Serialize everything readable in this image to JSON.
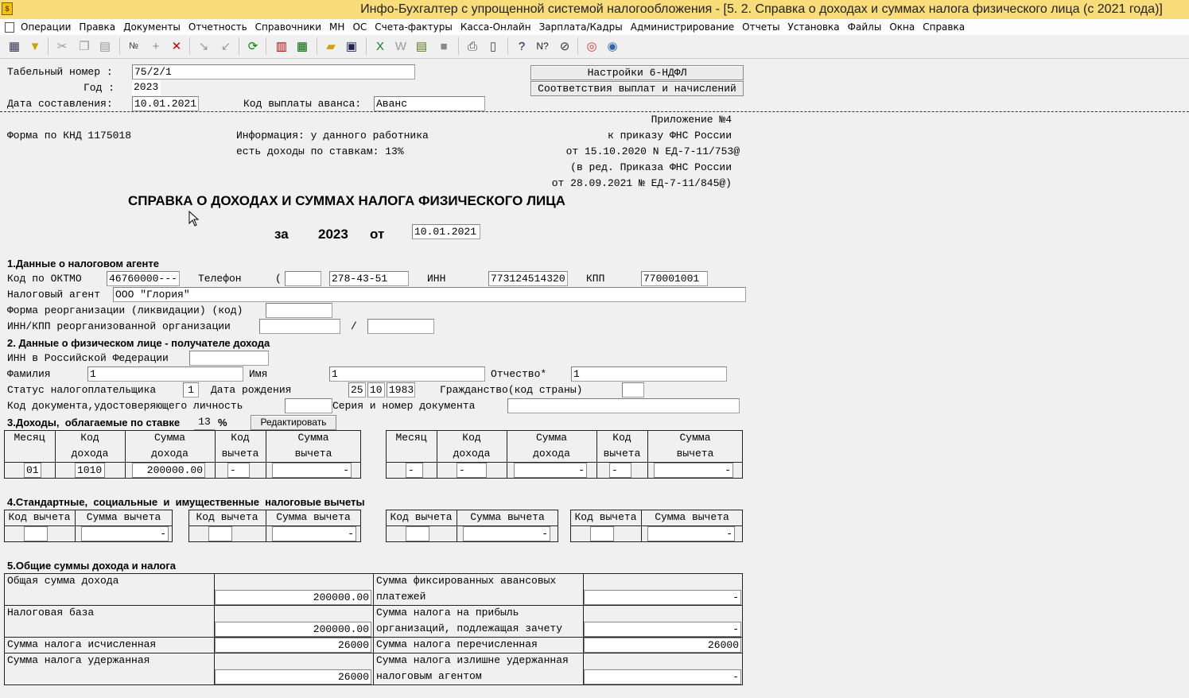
{
  "window": {
    "title": "Инфо-Бухгалтер с упрощенной системой налогообложения - [5.  2. Справка о доходах и суммах налога физического лица (с 2021 года)]",
    "icon": "app-icon"
  },
  "menu": [
    "Операции",
    "Правка",
    "Документы",
    "Отчетность",
    "Справочники",
    "МН",
    "ОС",
    "Счета-фактуры",
    "Касса-Онлайн",
    "Зарплата/Кадры",
    "Администрирование",
    "Отчеты",
    "Установка",
    "Файлы",
    "Окна",
    "Справка"
  ],
  "header": {
    "tabnum_label": "Табельный номер :",
    "tabnum_value": "75/2/1",
    "year_label": "Год :",
    "year_value": "2023",
    "date_label": "Дата составления:",
    "date_value": "10.01.2021",
    "advance_label": "Код выплаты аванса:",
    "advance_value": "Аванс",
    "btn_settings": "Настройки 6-НДФЛ",
    "btn_mapping": "Соответствия выплат и начислений"
  },
  "form_info": {
    "knd": "Форма по КНД 1175018",
    "info1": "Информация: у данного работника",
    "info2": "есть доходы по ставкам: 13%",
    "app1": "Приложение №4",
    "app2": "к приказу ФНС России",
    "app3": "от 15.10.2020 N ЕД-7-11/753@",
    "app4": "(в ред. Приказа ФНС России",
    "app5": "от 28.09.2021 № ЕД-7-11/845@)",
    "title": "СПРАВКА О ДОХОДАХ И СУММАХ НАЛОГА ФИЗИЧЕСКОГО ЛИЦА",
    "za": "за",
    "year": "2023",
    "ot": "от",
    "date": "10.01.2021"
  },
  "section1": {
    "heading": "1.Данные о налоговом агенте",
    "oktmo_label": "Код по ОКТМО",
    "oktmo_value": "46760000---",
    "phone_label": "Телефон",
    "phone_paren": "(",
    "phone_code": "",
    "phone_value": "278-43-51",
    "inn_label": "ИНН",
    "inn_value": "773124514320",
    "kpp_label": "КПП",
    "kpp_value": "770001001",
    "agent_label": "Налоговый агент",
    "agent_value": "ООО \"Глория\"",
    "reorg_label": "Форма реорганизации (ликвидации) (код)",
    "reorg_value": "",
    "reorg_inn_label": "ИНН/КПП реорганизованной организации",
    "slash": "/"
  },
  "section2": {
    "heading": "2. Данные о физическом лице - получателе дохода",
    "inn_label": "ИНН в Российской Федерации",
    "inn_value": "",
    "surname_label": "Фамилия",
    "surname_value": "1",
    "name_label": "Имя",
    "name_value": "1",
    "patronymic_label": "Отчество*",
    "patronymic_value": "1",
    "status_label": "Статус налогоплательщика",
    "status_value": "1",
    "birth_label": "Дата рождения",
    "birth_d": "25",
    "birth_m": "10",
    "birth_y": "1983",
    "citizen_label": "Гражданство(код страны)",
    "citizen_value": "",
    "doc_label": "Код документа,удостоверяющего личность",
    "doc_value": "",
    "series_label": "Серия и номер документа",
    "series_value": ""
  },
  "section3": {
    "heading": "3.Доходы,  облагаемые по ставке",
    "rate": "13",
    "pct": "%",
    "edit_btn": "Редактировать",
    "headers": [
      [
        "Месяц",
        ""
      ],
      [
        "Код",
        "дохода"
      ],
      [
        "Сумма",
        "дохода"
      ],
      [
        "Код",
        "вычета"
      ],
      [
        "Сумма",
        "вычета"
      ]
    ],
    "left_row": [
      "01",
      "1010",
      "200000.00",
      "-",
      "-"
    ],
    "right_row": [
      "-",
      "-",
      "-",
      "-",
      "-"
    ]
  },
  "section4": {
    "heading": "4.Стандартные,  социальные  и  имущественные  налоговые вычеты",
    "col1": "Код вычета",
    "col2": "Сумма вычета",
    "blocks": [
      [
        "",
        "-"
      ],
      [
        "",
        "-"
      ],
      [
        "",
        "-"
      ],
      [
        "",
        "-"
      ]
    ]
  },
  "section5": {
    "heading": "5.Общие суммы дохода и налога",
    "total_income_label": "Общая сумма дохода",
    "total_income": "200000.00",
    "tax_base_label": "Налоговая база",
    "tax_base": "200000.00",
    "tax_calc_label": "Сумма налога исчисленная",
    "tax_calc": "26000",
    "tax_withheld_label": "Сумма налога удержанная",
    "tax_withheld": "26000",
    "fixed_adv_label1": "Сумма фиксированных авансовых",
    "fixed_adv_label2": "платежей",
    "fixed_adv": "-",
    "profit_label1": "Сумма налога на прибыль",
    "profit_label2": "организаций, подлежащая зачету",
    "profit": "-",
    "transferred_label": "Сумма налога перечисленная",
    "transferred": "26000",
    "excess_label1": "Сумма налога излишне удержанная",
    "excess_label2": "налоговым агентом",
    "excess": "-"
  }
}
